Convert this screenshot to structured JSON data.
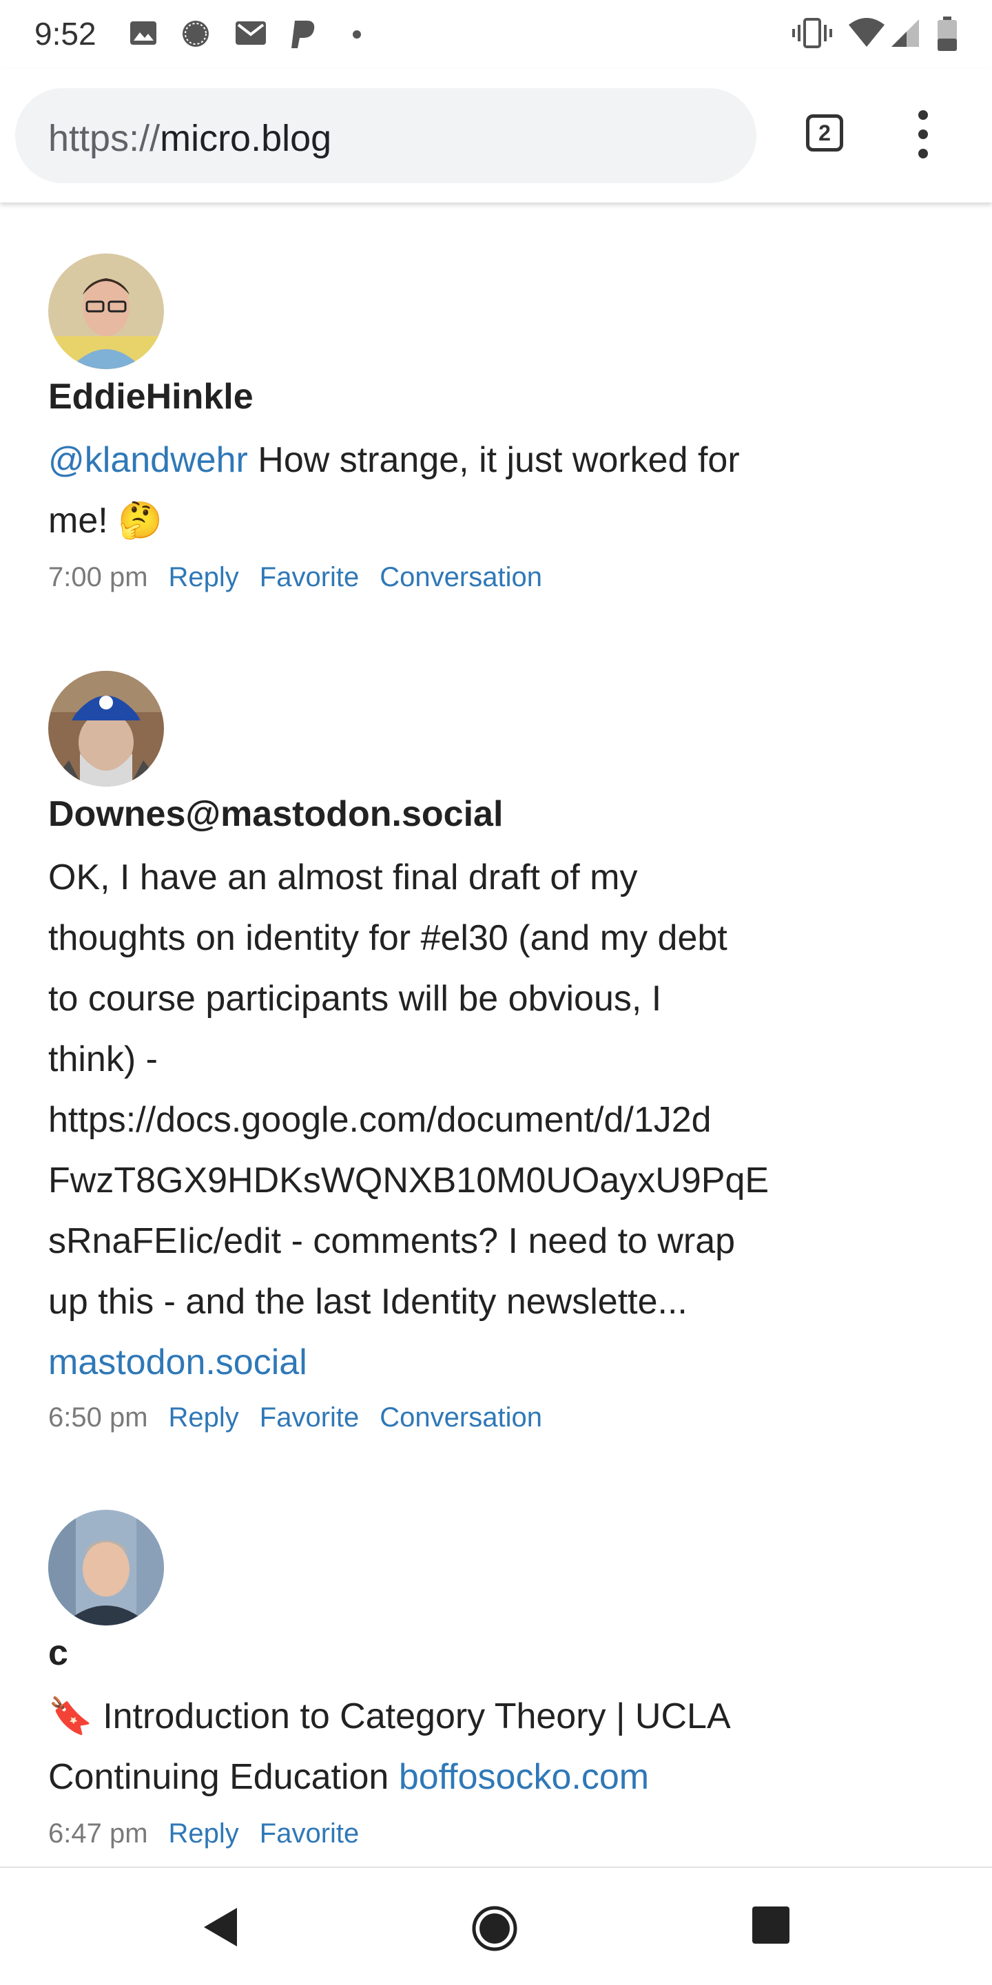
{
  "status_bar": {
    "time": "9:52",
    "left_icons": [
      "image-icon",
      "chat-bubble-icon",
      "gmail-icon",
      "paypal-icon",
      "dot-icon"
    ],
    "right_icons": [
      "vibrate-icon",
      "wifi-icon",
      "signal-icon",
      "battery-icon"
    ]
  },
  "browser": {
    "url_scheme": "https://",
    "url_host": "micro.blog",
    "tab_count": "2"
  },
  "posts": [
    {
      "author": "EddieHinkle",
      "mention": "@klandwehr",
      "text_line1_rest": " How strange, it just worked for",
      "text_line2": "me! 🤔",
      "time": "7:00 pm",
      "actions": [
        "Reply",
        "Favorite",
        "Conversation"
      ]
    },
    {
      "author": "Downes@mastodon.social",
      "lines": [
        "OK, I have an almost final draft of my",
        "thoughts on identity for #el30 (and my debt",
        "to course participants will be obvious, I",
        "think) -",
        "https://docs.google.com/document/d/1J2d",
        "FwzT8GX9HDKsWQNXB10M0UOayxU9PqE",
        "sRnaFEIic/edit - comments? I need to wrap",
        "up this - and the last Identity newslette..."
      ],
      "source_link": "mastodon.social",
      "time": "6:50 pm",
      "actions": [
        "Reply",
        "Favorite",
        "Conversation"
      ]
    },
    {
      "author": "c",
      "line1": "🔖 Introduction to Category Theory | UCLA",
      "line2_text": "Continuing Education ",
      "line2_link": "boffosocko.com",
      "time": "6:47 pm",
      "actions": [
        "Reply",
        "Favorite"
      ]
    }
  ],
  "nav": {
    "back": "back-icon",
    "home": "home-icon",
    "recents": "recents-icon"
  },
  "colors": {
    "link": "#2f78b7",
    "url_field": "#f1f3f4"
  }
}
